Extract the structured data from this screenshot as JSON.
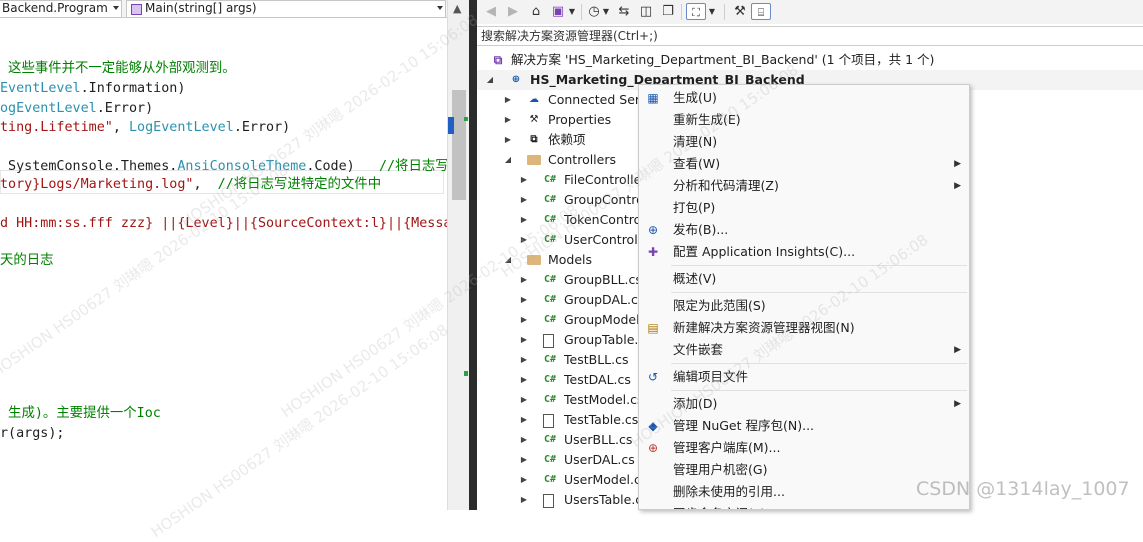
{
  "editor": {
    "nav_class": "Backend.Program",
    "nav_method": "Main(string[] args)",
    "lines": [
      {
        "segments": [
          {
            "text": " 这些事件并不一定能够从外部观测到。",
            "kind": "comment"
          }
        ]
      },
      {
        "segments": [
          {
            "text": "EventLevel",
            "kind": "type"
          },
          {
            "text": ".Information)",
            "kind": "text"
          }
        ]
      },
      {
        "segments": [
          {
            "text": "ogEventLevel",
            "kind": "type"
          },
          {
            "text": ".Error)",
            "kind": "text"
          }
        ]
      },
      {
        "segments": [
          {
            "text": "ting.Lifetime\"",
            "kind": "string"
          },
          {
            "text": ", ",
            "kind": "text"
          },
          {
            "text": "LogEventLevel",
            "kind": "type"
          },
          {
            "text": ".Error)",
            "kind": "text"
          }
        ]
      },
      {
        "segments": [
          {
            "text": " SystemConsole.Themes.",
            "kind": "text"
          },
          {
            "text": "AnsiConsoleTheme",
            "kind": "type"
          },
          {
            "text": ".Code)   ",
            "kind": "text"
          },
          {
            "text": "//将日志写",
            "kind": "comment"
          }
        ]
      },
      {
        "segments": [
          {
            "text": "tory}Logs/Marketing.log\"",
            "kind": "string"
          },
          {
            "text": ",  ",
            "kind": "text"
          },
          {
            "text": "//将日志写进特定的文件中",
            "kind": "comment"
          }
        ]
      },
      {
        "segments": [
          {
            "text": "d HH:mm:ss.fff zzz} ||{Level}||{SourceContext:l}||{Messag",
            "kind": "string"
          }
        ]
      },
      {
        "segments": [
          {
            "text": "天的日志",
            "kind": "comment"
          }
        ]
      },
      {
        "segments": [
          {
            "text": " 生成)。主要提供一个Ioc",
            "kind": "comment"
          }
        ]
      },
      {
        "segments": [
          {
            "text": "r(args);",
            "kind": "text"
          }
        ]
      }
    ]
  },
  "solution_explorer": {
    "toolbar": {
      "back_icon": "back-icon",
      "forward_icon": "forward-icon",
      "home_icon": "home-icon"
    },
    "search_placeholder": "搜索解决方案资源管理器(Ctrl+;)",
    "solution_label": "解决方案 'HS_Marketing_Department_BI_Backend' (1 个项目，共 1 个)",
    "project_label": "HS_Marketing_Department_BI_Backend",
    "tree": [
      {
        "label": "Connected Services",
        "icon": "connected-services-icon",
        "level": 1,
        "arrow": "right"
      },
      {
        "label": "Properties",
        "icon": "wrench-folder-icon",
        "level": 1,
        "arrow": "right"
      },
      {
        "label": "依赖项",
        "icon": "dependencies-icon",
        "level": 1,
        "arrow": "right"
      },
      {
        "label": "Controllers",
        "icon": "folder-icon",
        "level": 1,
        "arrow": "down"
      },
      {
        "label": "FileController.cs",
        "icon": "csharp-file-icon",
        "level": 2,
        "arrow": "right"
      },
      {
        "label": "GroupController.cs",
        "icon": "csharp-file-icon",
        "level": 2,
        "arrow": "right"
      },
      {
        "label": "TokenController.cs",
        "icon": "csharp-file-icon",
        "level": 2,
        "arrow": "right"
      },
      {
        "label": "UserController.cs",
        "icon": "csharp-file-icon",
        "level": 2,
        "arrow": "right"
      },
      {
        "label": "Models",
        "icon": "folder-icon",
        "level": 1,
        "arrow": "down"
      },
      {
        "label": "GroupBLL.cs",
        "icon": "csharp-file-icon",
        "level": 2,
        "arrow": "right"
      },
      {
        "label": "GroupDAL.cs",
        "icon": "csharp-file-icon",
        "level": 2,
        "arrow": "right"
      },
      {
        "label": "GroupModel.cs",
        "icon": "csharp-file-icon",
        "level": 2,
        "arrow": "right"
      },
      {
        "label": "GroupTable.cs",
        "icon": "table-file-icon",
        "level": 2,
        "arrow": "right"
      },
      {
        "label": "TestBLL.cs",
        "icon": "csharp-file-icon",
        "level": 2,
        "arrow": "right"
      },
      {
        "label": "TestDAL.cs",
        "icon": "csharp-file-icon",
        "level": 2,
        "arrow": "right"
      },
      {
        "label": "TestModel.cs",
        "icon": "csharp-file-icon",
        "level": 2,
        "arrow": "right"
      },
      {
        "label": "TestTable.cs",
        "icon": "table-file-icon",
        "level": 2,
        "arrow": "right"
      },
      {
        "label": "UserBLL.cs",
        "icon": "csharp-file-icon",
        "level": 2,
        "arrow": "right"
      },
      {
        "label": "UserDAL.cs",
        "icon": "csharp-file-icon",
        "level": 2,
        "arrow": "right"
      },
      {
        "label": "UserModel.cs",
        "icon": "csharp-file-icon",
        "level": 2,
        "arrow": "right"
      },
      {
        "label": "UsersTable.cs",
        "icon": "table-file-icon",
        "level": 2,
        "arrow": "right"
      }
    ]
  },
  "context_menu": {
    "items": [
      {
        "label": "生成(U)",
        "icon": "build-icon",
        "submenu": false
      },
      {
        "label": "重新生成(E)",
        "icon": "",
        "submenu": false
      },
      {
        "label": "清理(N)",
        "icon": "",
        "submenu": false
      },
      {
        "label": "查看(W)",
        "icon": "",
        "submenu": true
      },
      {
        "label": "分析和代码清理(Z)",
        "icon": "",
        "submenu": true
      },
      {
        "label": "打包(P)",
        "icon": "",
        "submenu": false
      },
      {
        "label": "发布(B)...",
        "icon": "globe-icon",
        "submenu": false
      },
      {
        "label": "配置 Application Insights(C)...",
        "icon": "insights-icon",
        "submenu": false
      },
      {
        "label": "概述(V)",
        "icon": "",
        "submenu": false
      },
      {
        "label": "限定为此范围(S)",
        "icon": "",
        "submenu": false
      },
      {
        "label": "新建解决方案资源管理器视图(N)",
        "icon": "new-view-icon",
        "submenu": false
      },
      {
        "label": "文件嵌套",
        "icon": "",
        "submenu": true
      },
      {
        "label": "编辑项目文件",
        "icon": "edit-file-icon",
        "submenu": false
      },
      {
        "label": "添加(D)",
        "icon": "",
        "submenu": true
      },
      {
        "label": "管理 NuGet 程序包(N)...",
        "icon": "nuget-icon",
        "submenu": false
      },
      {
        "label": "管理客户端库(M)...",
        "icon": "client-lib-icon",
        "submenu": false
      },
      {
        "label": "管理用户机密(G)",
        "icon": "",
        "submenu": false
      },
      {
        "label": "删除未使用的引用...",
        "icon": "",
        "submenu": false
      },
      {
        "label": "同步命名空间(Y)",
        "icon": "",
        "submenu": false
      }
    ]
  },
  "watermark": {
    "csdn": "CSDN @1314lay_1007",
    "user": "HOSHION HS00627 刘琳嗯 2026-02-10 15:06:08"
  }
}
